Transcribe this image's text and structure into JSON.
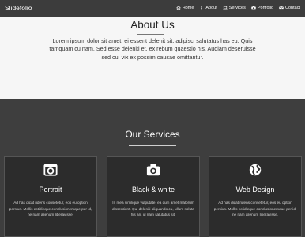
{
  "navbar": {
    "brand": "Slidefolio",
    "items": [
      {
        "label": "Home",
        "icon": "home-icon"
      },
      {
        "label": "About",
        "icon": "info-icon"
      },
      {
        "label": "Services",
        "icon": "laptop-icon"
      },
      {
        "label": "Portfolio",
        "icon": "camera-icon"
      },
      {
        "label": "Contact",
        "icon": "envelope-icon"
      }
    ]
  },
  "about": {
    "title": "About Us",
    "text": "Lorem ipsum dolor sit amet, ei essent delenit sit, adipisci salutatus has eu. Quis tamquam cu nam. Sed esse deleniti et, ex rebum quaestio his. Audiam deseruisse sed cu, vix ex possim causae omittantur."
  },
  "services": {
    "title": "Our Services",
    "cards": [
      {
        "title": "Portrait",
        "icon": "camera-retro-icon",
        "text": "Ad has dicat ridens consetetur, eos eu option persius. Mollis cotidieque conclusionemque per id, ne nam alienum liberavisse."
      },
      {
        "title": "Black & white",
        "icon": "camera-icon",
        "text": "In mea similique vulputate, ea cum amet malorum dissentiunt. Qui deleniti aliquando cu, ullum soluta his an, id nam salutatus sit."
      },
      {
        "title": "Web Design",
        "icon": "globe-icon",
        "text": "Ad has dicat ridens consetetur, eos eu option persius. Mollis cotidieque conclusionemque per id, ne nam alienum liberavisse."
      }
    ]
  }
}
